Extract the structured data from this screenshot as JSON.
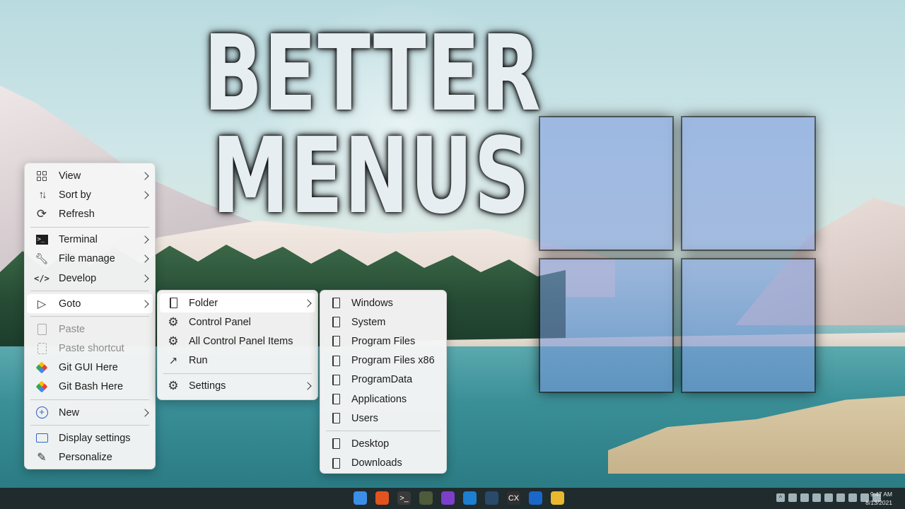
{
  "title": {
    "line1": "BETTER",
    "line2": "MENUS"
  },
  "main_menu": {
    "groups": [
      [
        {
          "label": "View",
          "icon": "view-grid-icon",
          "submenu": true,
          "disabled": false
        },
        {
          "label": "Sort by",
          "icon": "sort-icon",
          "submenu": true,
          "disabled": false
        },
        {
          "label": "Refresh",
          "icon": "refresh-icon",
          "submenu": false,
          "disabled": false
        }
      ],
      [
        {
          "label": "Terminal",
          "icon": "terminal-icon",
          "submenu": true,
          "disabled": false
        },
        {
          "label": "File manage",
          "icon": "wrench-icon",
          "submenu": true,
          "disabled": false
        },
        {
          "label": "Develop",
          "icon": "code-icon",
          "submenu": true,
          "disabled": false
        }
      ],
      [
        {
          "label": "Goto",
          "icon": "cursor-icon",
          "submenu": true,
          "disabled": false,
          "active": true
        }
      ],
      [
        {
          "label": "Paste",
          "icon": "clipboard-icon",
          "submenu": false,
          "disabled": true
        },
        {
          "label": "Paste shortcut",
          "icon": "clipboard-shortcut-icon",
          "submenu": false,
          "disabled": true
        },
        {
          "label": "Git GUI Here",
          "icon": "git-icon",
          "submenu": false,
          "disabled": false
        },
        {
          "label": "Git Bash Here",
          "icon": "git-icon",
          "submenu": false,
          "disabled": false
        }
      ],
      [
        {
          "label": "New",
          "icon": "plus-circle-icon",
          "submenu": true,
          "disabled": false
        }
      ],
      [
        {
          "label": "Display settings",
          "icon": "monitor-icon",
          "submenu": false,
          "disabled": false
        },
        {
          "label": "Personalize",
          "icon": "pen-icon",
          "submenu": false,
          "disabled": false
        }
      ]
    ]
  },
  "goto_menu": {
    "groups": [
      [
        {
          "label": "Folder",
          "icon": "folder-icon",
          "submenu": true,
          "active": true
        },
        {
          "label": "Control Panel",
          "icon": "gear-icon",
          "submenu": false
        },
        {
          "label": "All Control Panel Items",
          "icon": "gear-icon",
          "submenu": false
        },
        {
          "label": "Run",
          "icon": "run-arrow-icon",
          "submenu": false
        }
      ],
      [
        {
          "label": "Settings",
          "icon": "gear-icon",
          "submenu": true
        }
      ]
    ]
  },
  "folder_menu": {
    "groups": [
      [
        {
          "label": "Windows",
          "icon": "folder-icon"
        },
        {
          "label": "System",
          "icon": "folder-icon"
        },
        {
          "label": "Program Files",
          "icon": "folder-icon"
        },
        {
          "label": "Program Files x86",
          "icon": "folder-icon"
        },
        {
          "label": "ProgramData",
          "icon": "folder-icon"
        },
        {
          "label": "Applications",
          "icon": "folder-icon"
        },
        {
          "label": "Users",
          "icon": "folder-icon"
        }
      ],
      [
        {
          "label": "Desktop",
          "icon": "folder-icon"
        },
        {
          "label": "Downloads",
          "icon": "folder-icon"
        }
      ]
    ]
  },
  "taskbar": {
    "apps": [
      {
        "name": "windows-start-icon",
        "glyph": "",
        "color": "#3b8fe8"
      },
      {
        "name": "brave-icon",
        "glyph": "",
        "color": "#e2541f"
      },
      {
        "name": "terminal-icon",
        "glyph": ">_",
        "color": "#3a3a3a"
      },
      {
        "name": "app-icon",
        "glyph": "",
        "color": "#4d5b3a"
      },
      {
        "name": "github-icon",
        "glyph": "",
        "color": "#7b3fc9"
      },
      {
        "name": "vscode-icon",
        "glyph": "",
        "color": "#1d7fd1"
      },
      {
        "name": "steam-icon",
        "glyph": "",
        "color": "#2a4a6b"
      },
      {
        "name": "cx-app-icon",
        "glyph": "CX",
        "color": "#2f2f2f"
      },
      {
        "name": "edge-dev-icon",
        "glyph": "",
        "color": "#1967c9"
      },
      {
        "name": "file-explorer-icon",
        "glyph": "",
        "color": "#e8b92e"
      }
    ],
    "time": "9:47 AM",
    "date": "8/13/2021"
  },
  "colors": {
    "menu_bg": "#f5f5f5",
    "menu_active_bg": "#ffffff",
    "logo_pane": "#7896dc",
    "taskbar_bg": "#1f2b2d"
  }
}
